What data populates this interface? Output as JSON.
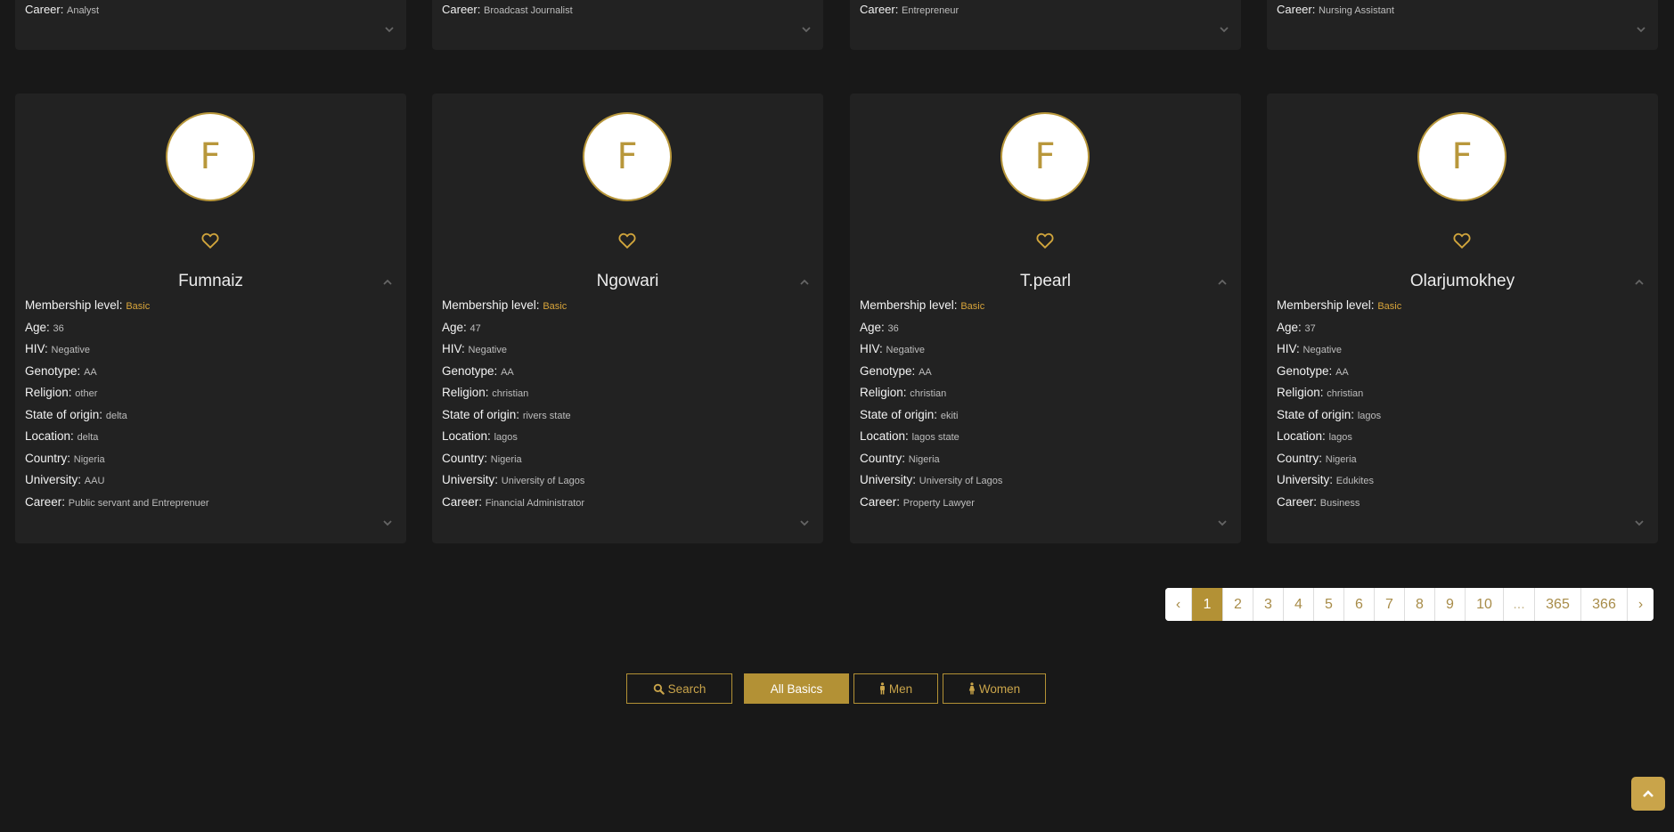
{
  "top_cards": [
    {
      "label": "Career:",
      "value": "Analyst"
    },
    {
      "label": "Career:",
      "value": "Broadcast Journalist"
    },
    {
      "label": "Career:",
      "value": "Entrepreneur"
    },
    {
      "label": "Career:",
      "value": "Nursing Assistant"
    }
  ],
  "labels": {
    "membership": "Membership level:",
    "age": "Age:",
    "hiv": "HIV:",
    "genotype": "Genotype:",
    "religion": "Religion:",
    "state": "State of origin:",
    "location": "Location:",
    "country": "Country:",
    "university": "University:",
    "career": "Career:"
  },
  "profiles": [
    {
      "initial": "F",
      "name": "Fumnaiz",
      "membership": "Basic",
      "age": "36",
      "hiv": "Negative",
      "genotype": "AA",
      "religion": "other",
      "state": "delta",
      "location": "delta",
      "country": "Nigeria",
      "university": "AAU",
      "career": "Public servant and Entreprenuer"
    },
    {
      "initial": "F",
      "name": "Ngowari",
      "membership": "Basic",
      "age": "47",
      "hiv": "Negative",
      "genotype": "AA",
      "religion": "christian",
      "state": "rivers state",
      "location": "lagos",
      "country": "Nigeria",
      "university": "University of Lagos",
      "career": "Financial Administrator"
    },
    {
      "initial": "F",
      "name": "T.pearl",
      "membership": "Basic",
      "age": "36",
      "hiv": "Negative",
      "genotype": "AA",
      "religion": "christian",
      "state": "ekiti",
      "location": "lagos state",
      "country": "Nigeria",
      "university": "University of Lagos",
      "career": "Property Lawyer"
    },
    {
      "initial": "F",
      "name": "Olarjumokhey",
      "membership": "Basic",
      "age": "37",
      "hiv": "Negative",
      "genotype": "AA",
      "religion": "christian",
      "state": "lagos",
      "location": "lagos",
      "country": "Nigeria",
      "university": "Edukites",
      "career": "Business"
    }
  ],
  "pagination": {
    "prev": "‹",
    "pages": [
      "1",
      "2",
      "3",
      "4",
      "5",
      "6",
      "7",
      "8",
      "9",
      "10",
      "...",
      "365",
      "366"
    ],
    "next": "›",
    "active": "1"
  },
  "filters": {
    "search": "Search",
    "all_basics": "All Basics",
    "men": "Men",
    "women": "Women"
  },
  "colors": {
    "accent": "#b39135",
    "background": "#181818",
    "card": "#222222",
    "membership": "#d8a43a"
  },
  "icons": {
    "heart": "heart-icon",
    "collapse": "chevron-up-icon",
    "expand": "chevron-down-icon",
    "search": "search-icon",
    "male": "male-icon",
    "female": "female-icon",
    "scroll_top": "chevron-up-icon"
  }
}
